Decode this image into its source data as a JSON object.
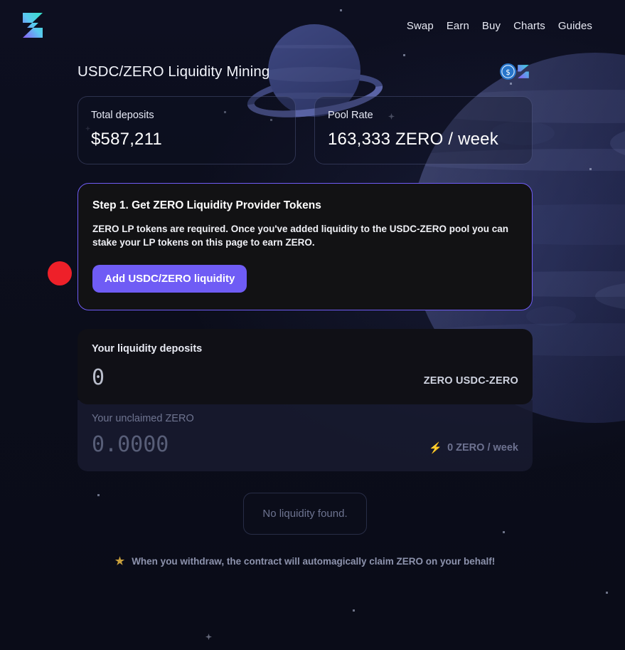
{
  "brand": {
    "logo_icon": "zero-logo-icon",
    "logo_alt": "ZERO"
  },
  "nav": {
    "items": [
      {
        "label": "Swap",
        "name": "nav-link-swap"
      },
      {
        "label": "Earn",
        "name": "nav-link-earn"
      },
      {
        "label": "Buy",
        "name": "nav-link-buy"
      },
      {
        "label": "Charts",
        "name": "nav-link-charts"
      },
      {
        "label": "Guides",
        "name": "nav-link-guides"
      }
    ]
  },
  "header": {
    "title": "USDC/ZERO Liquidity Mining",
    "token_icons": [
      "usdc-token-icon",
      "zero-token-icon"
    ]
  },
  "stats": [
    {
      "label": "Total deposits",
      "value": "$587,211"
    },
    {
      "label": "Pool Rate",
      "value": "163,333 ZERO / week"
    }
  ],
  "step_card": {
    "title": "Step 1. Get ZERO Liquidity Provider Tokens",
    "body": "ZERO LP tokens are required. Once you've added liquidity to the USDC-ZERO pool you can stake your LP tokens on this page to earn ZERO.",
    "button_label": "Add USDC/ZERO liquidity"
  },
  "deposits": {
    "title": "Your liquidity deposits",
    "amount": "0",
    "unit": "ZERO USDC-ZERO"
  },
  "unclaimed": {
    "title": "Your unclaimed ZERO",
    "amount": "0.0000",
    "rate": "0 ZERO / week",
    "rate_icon": "lightning-bolt-icon"
  },
  "empty_state": {
    "message": "No liquidity found."
  },
  "footer": {
    "icon": "star-icon",
    "note": "When you withdraw, the contract will automagically claim ZERO on your behalf!"
  },
  "annotation": {
    "marker": "red-circle-marker",
    "color": "#ee2029"
  },
  "colors": {
    "background": "#0c0e1c",
    "accent": "#6f5cf5",
    "card_dark": "#121214",
    "text_primary": "#ffffff",
    "text_muted": "#6d7390",
    "gold": "#c9a03c"
  }
}
